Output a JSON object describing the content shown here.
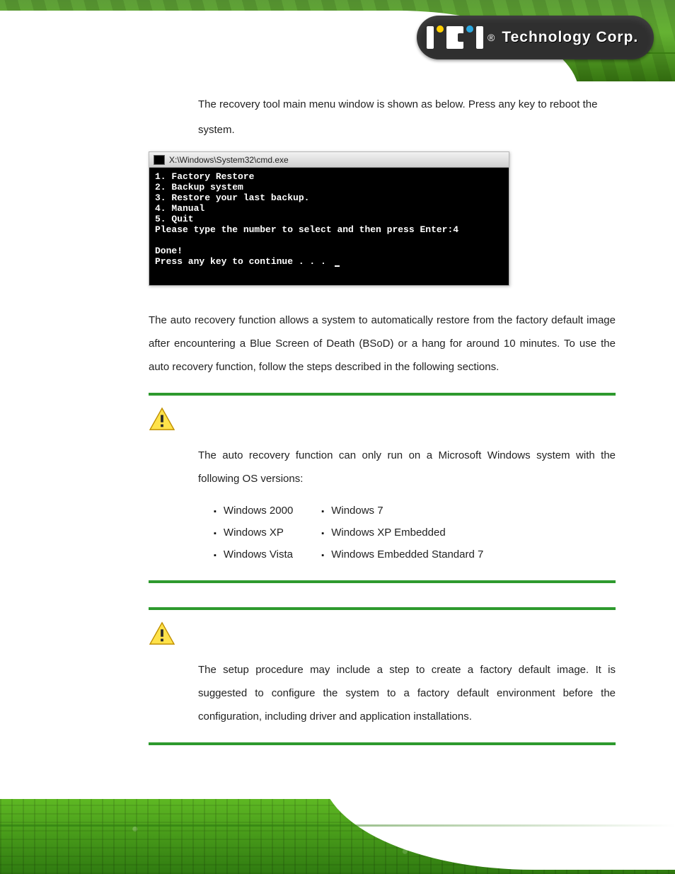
{
  "brand": {
    "reg": "®",
    "name": "Technology Corp."
  },
  "intro": "The recovery tool main menu window is shown as below. Press any key to reboot the system.",
  "cmd": {
    "title": "X:\\Windows\\System32\\cmd.exe",
    "body": "1. Factory Restore\n2. Backup system\n3. Restore your last backup.\n4. Manual\n5. Quit\nPlease type the number to select and then press Enter:4\n\nDone!\nPress any key to continue . . . "
  },
  "para": "The auto recovery function allows a system to automatically restore from the factory default image after encountering a Blue Screen of Death (BSoD) or a hang for around 10 minutes. To use the auto recovery function, follow the steps described in the following sections.",
  "warn1": {
    "text": "The auto recovery function can only run on a Microsoft Windows system with the following OS versions:",
    "col1": [
      "Windows 2000",
      "Windows XP",
      "Windows Vista"
    ],
    "col2": [
      "Windows 7",
      "Windows XP Embedded",
      "Windows Embedded Standard 7"
    ]
  },
  "warn2": {
    "text": "The setup procedure may include a step to create a factory default image. It is suggested to configure the system to a factory default environment before the configuration, including driver and application installations."
  }
}
